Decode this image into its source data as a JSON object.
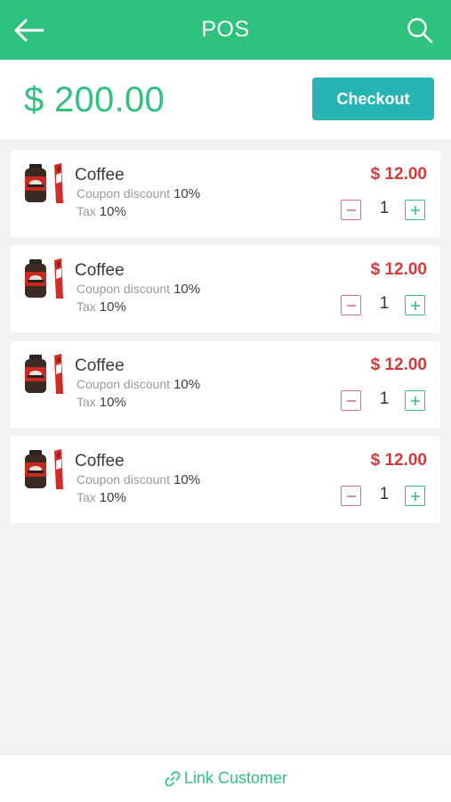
{
  "header": {
    "title": "POS",
    "back_icon": "arrow-left-icon",
    "search_icon": "search-icon"
  },
  "summary": {
    "total": "$ 200.00",
    "checkout_label": "Checkout"
  },
  "items": [
    {
      "name": "Coffee",
      "coupon_label": "Coupon discount",
      "coupon_value": "10%",
      "tax_label": "Tax",
      "tax_value": "10%",
      "price": "$ 12.00",
      "quantity": "1"
    },
    {
      "name": "Coffee",
      "coupon_label": "Coupon discount",
      "coupon_value": "10%",
      "tax_label": "Tax",
      "tax_value": "10%",
      "price": "$ 12.00",
      "quantity": "1"
    },
    {
      "name": "Coffee",
      "coupon_label": "Coupon discount",
      "coupon_value": "10%",
      "tax_label": "Tax",
      "tax_value": "10%",
      "price": "$ 12.00",
      "quantity": "1"
    },
    {
      "name": "Coffee",
      "coupon_label": "Coupon discount",
      "coupon_value": "10%",
      "tax_label": "Tax",
      "tax_value": "10%",
      "price": "$ 12.00",
      "quantity": "1"
    }
  ],
  "footer": {
    "link_label": "Link Customer",
    "link_icon": "link-icon"
  },
  "colors": {
    "primary_green": "#2ec27e",
    "checkout_teal": "#26b5b2",
    "price_red": "#d23b3b",
    "background": "#f1f2f2"
  }
}
